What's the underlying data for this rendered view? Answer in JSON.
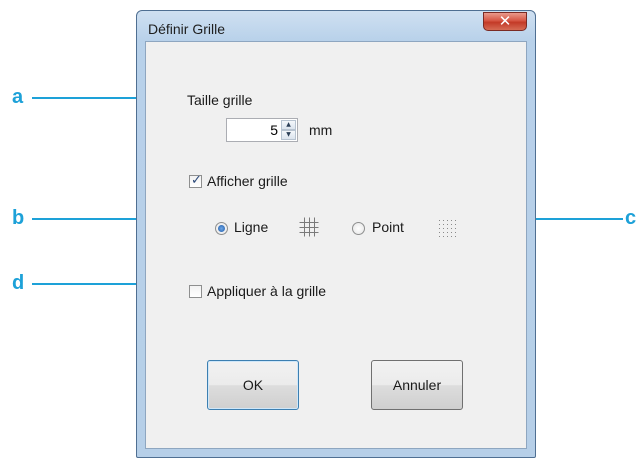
{
  "window": {
    "title": "Définir Grille",
    "close_glyph": "✕"
  },
  "grid_size": {
    "label": "Taille grille",
    "value": "5",
    "unit": "mm"
  },
  "show_grid": {
    "label": "Afficher grille",
    "checked": true
  },
  "grid_style": {
    "options": [
      {
        "label": "Ligne",
        "selected": true,
        "icon": "grid-lines-icon"
      },
      {
        "label": "Point",
        "selected": false,
        "icon": "grid-dots-icon"
      }
    ]
  },
  "snap_to_grid": {
    "label": "Appliquer à la grille",
    "checked": false
  },
  "buttons": {
    "ok_label": "OK",
    "cancel_label": "Annuler"
  },
  "callouts": {
    "a": "a",
    "b": "b",
    "c": "c",
    "d": "d"
  },
  "colors": {
    "callout": "#1da1d8",
    "close_button": "#c33a27",
    "window_frame": "#b8d1ea"
  }
}
